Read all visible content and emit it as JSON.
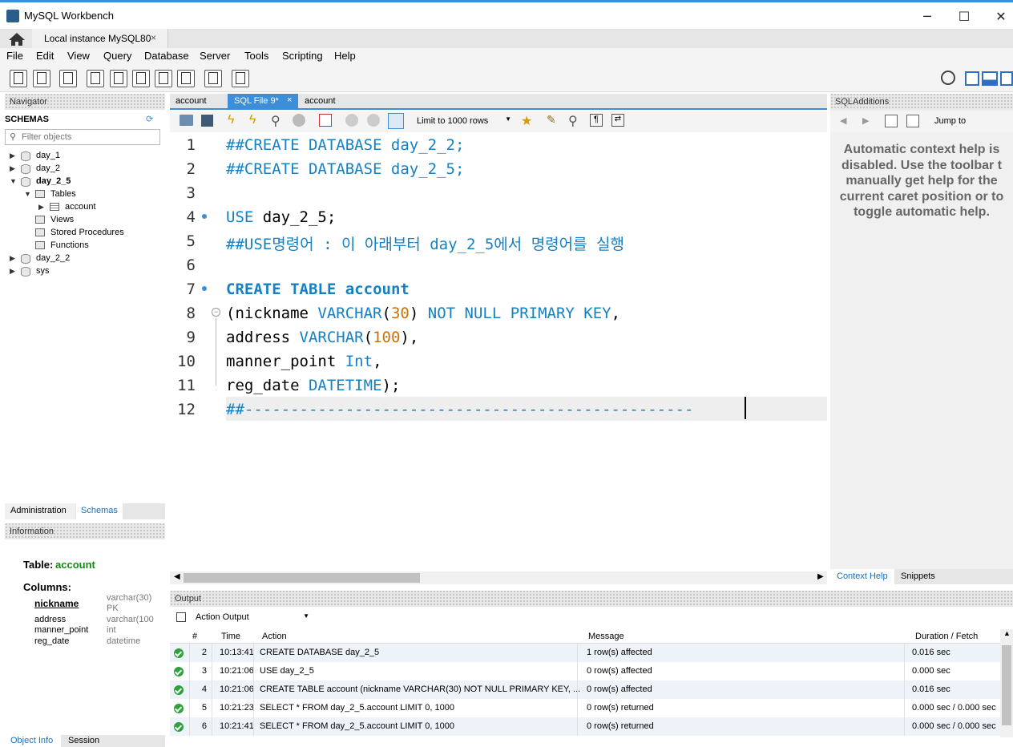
{
  "window": {
    "title": "MySQL Workbench"
  },
  "tabs": {
    "connection": "Local instance MySQL80",
    "close": "×"
  },
  "menu": [
    "File",
    "Edit",
    "View",
    "Query",
    "Database",
    "Server",
    "Tools",
    "Scripting",
    "Help"
  ],
  "navigator": {
    "header": "Navigator",
    "schemas_title": "SCHEMAS",
    "filter_placeholder": "Filter objects",
    "tree": [
      {
        "label": "day_1",
        "level": 0,
        "type": "db",
        "expanded": false
      },
      {
        "label": "day_2",
        "level": 0,
        "type": "db",
        "expanded": false
      },
      {
        "label": "day_2_5",
        "level": 0,
        "type": "db",
        "expanded": true,
        "bold": true
      },
      {
        "label": "Tables",
        "level": 1,
        "type": "folder",
        "expanded": true
      },
      {
        "label": "account",
        "level": 2,
        "type": "table",
        "expanded": false
      },
      {
        "label": "Views",
        "level": 1,
        "type": "folder"
      },
      {
        "label": "Stored Procedures",
        "level": 1,
        "type": "folder"
      },
      {
        "label": "Functions",
        "level": 1,
        "type": "folder"
      },
      {
        "label": "day_2_2",
        "level": 0,
        "type": "db",
        "expanded": false
      },
      {
        "label": "sys",
        "level": 0,
        "type": "db",
        "expanded": false
      }
    ],
    "tab_admin": "Administration",
    "tab_schemas": "Schemas"
  },
  "information": {
    "header": "Information",
    "table_label": "Table:",
    "table_name": "account",
    "columns_label": "Columns:",
    "columns": [
      {
        "name": "nickname",
        "type": "varchar(30)",
        "extra": "PK"
      },
      {
        "name": "address",
        "type": "varchar(100"
      },
      {
        "name": "manner_point",
        "type": "int"
      },
      {
        "name": "reg_date",
        "type": "datetime"
      }
    ],
    "tab_object_info": "Object Info",
    "tab_session": "Session"
  },
  "editor": {
    "tabs": [
      "account",
      "SQL File 9*",
      "account"
    ],
    "limit_label": "Limit to 1000 rows",
    "line_numbers": [
      "1",
      "2",
      "3",
      "4",
      "5",
      "6",
      "7",
      "8",
      "9",
      "10",
      "11",
      "12"
    ],
    "lines": [
      "##CREATE DATABASE day_2_2;",
      "##CREATE DATABASE day_2_5;",
      "",
      "USE day_2_5;",
      "##USE명령어 : 이 아래부터 day_2_5에서 명령어를 실행",
      "",
      "CREATE TABLE account",
      "(nickname VARCHAR(30) NOT NULL PRIMARY KEY,",
      "address VARCHAR(100),",
      "manner_point Int,",
      "reg_date DATETIME);",
      "##-------------------------------------------------"
    ]
  },
  "sql_additions": {
    "header": "SQLAdditions",
    "jump_to": "Jump to",
    "help_text": [
      "Automatic context help is",
      "disabled. Use the toolbar t",
      "manually get help for the",
      "current caret position or to",
      "toggle automatic help."
    ],
    "tab_context": "Context Help",
    "tab_snippets": "Snippets"
  },
  "output": {
    "header": "Output",
    "selector": "Action Output",
    "columns": [
      "#",
      "Time",
      "Action",
      "Message",
      "Duration / Fetch"
    ],
    "rows": [
      {
        "num": "2",
        "time": "10:13:41",
        "action": "CREATE DATABASE day_2_5",
        "message": "1 row(s) affected",
        "duration": "0.016 sec"
      },
      {
        "num": "3",
        "time": "10:21:06",
        "action": "USE day_2_5",
        "message": "0 row(s) affected",
        "duration": "0.000 sec"
      },
      {
        "num": "4",
        "time": "10:21:06",
        "action": "CREATE TABLE account (nickname VARCHAR(30) NOT NULL PRIMARY KEY, ...",
        "message": "0 row(s) affected",
        "duration": "0.016 sec"
      },
      {
        "num": "5",
        "time": "10:21:23",
        "action": "SELECT * FROM day_2_5.account LIMIT 0, 1000",
        "message": "0 row(s) returned",
        "duration": "0.000 sec / 0.000 sec"
      },
      {
        "num": "6",
        "time": "10:21:41",
        "action": "SELECT * FROM day_2_5.account LIMIT 0, 1000",
        "message": "0 row(s) returned",
        "duration": "0.000 sec / 0.000 sec"
      }
    ]
  },
  "colors": {
    "accent": "#3c8ed9",
    "keyword": "#1581c2",
    "number": "#c9730c",
    "ok": "#2ea03c"
  }
}
